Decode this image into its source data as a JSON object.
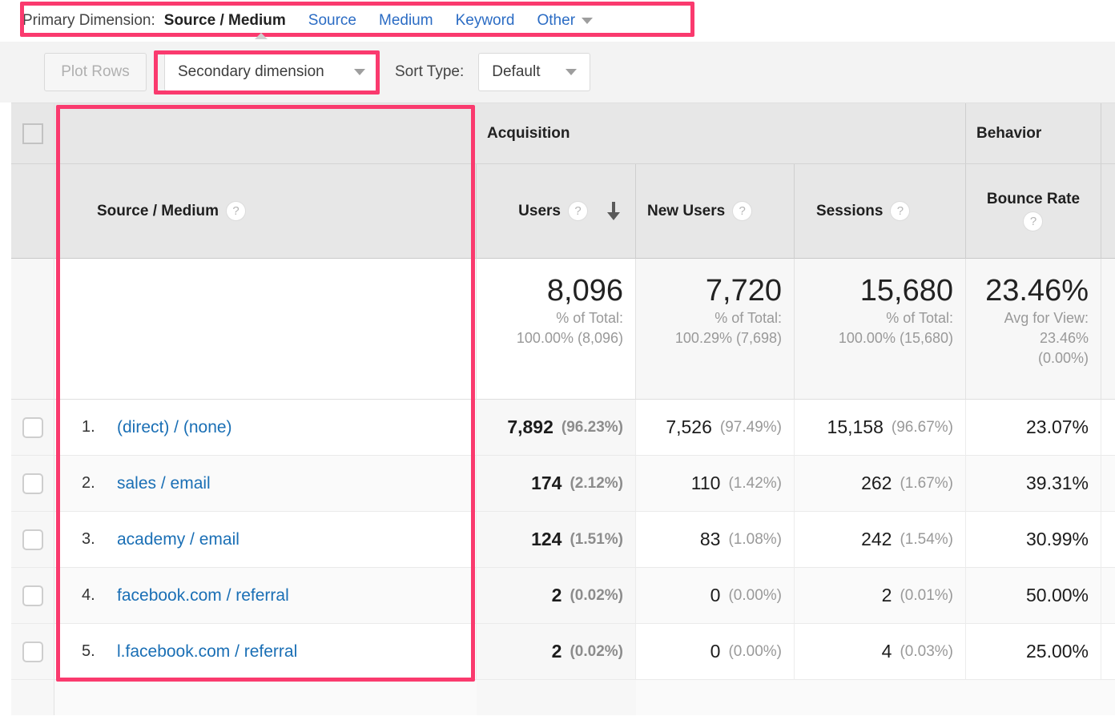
{
  "primary_dimension": {
    "label": "Primary Dimension:",
    "active": "Source / Medium",
    "links": [
      "Source",
      "Medium",
      "Keyword"
    ],
    "other": "Other",
    "other_caret_icon": "chevron-down-icon"
  },
  "controls": {
    "plot_rows_label": "Plot Rows",
    "secondary_dimension_label": "Secondary dimension",
    "secondary_dimension_caret_icon": "chevron-down-icon",
    "sort_type_label": "Sort Type:",
    "sort_type_value": "Default",
    "sort_type_caret_icon": "chevron-down-icon"
  },
  "highlight_color": "#fa3a6e",
  "link_color": "#1a6fb5",
  "table": {
    "groups": [
      {
        "label": "Acquisition"
      },
      {
        "label": "Behavior"
      }
    ],
    "dimension_header": {
      "label": "Source / Medium",
      "help_icon": "help-circle-icon"
    },
    "metrics": [
      {
        "label": "Users",
        "help_icon": "help-circle-icon",
        "sorted": true,
        "sort_icon": "arrow-down-icon"
      },
      {
        "label": "New Users",
        "help_icon": "help-circle-icon",
        "sorted": false
      },
      {
        "label": "Sessions",
        "help_icon": "help-circle-icon",
        "sorted": false
      },
      {
        "label": "Bounce Rate",
        "help_icon": "help-circle-icon",
        "sorted": false
      }
    ],
    "totals": [
      {
        "value": "8,096",
        "sub_label": "% of Total:",
        "sub_value": "100.00% (8,096)"
      },
      {
        "value": "7,720",
        "sub_label": "% of Total:",
        "sub_value": "100.29% (7,698)"
      },
      {
        "value": "15,680",
        "sub_label": "% of Total:",
        "sub_value": "100.00% (15,680)"
      },
      {
        "value": "23.46%",
        "sub_label": "Avg for View:",
        "sub_value": "23.46%",
        "sub_value2": "(0.00%)"
      }
    ],
    "rows": [
      {
        "index": "1.",
        "dimension": "(direct) / (none)",
        "users": "7,892",
        "users_pct": "(96.23%)",
        "new_users": "7,526",
        "new_users_pct": "(97.49%)",
        "sessions": "15,158",
        "sessions_pct": "(96.67%)",
        "bounce_rate": "23.07%"
      },
      {
        "index": "2.",
        "dimension": "sales / email",
        "users": "174",
        "users_pct": "(2.12%)",
        "new_users": "110",
        "new_users_pct": "(1.42%)",
        "sessions": "262",
        "sessions_pct": "(1.67%)",
        "bounce_rate": "39.31%"
      },
      {
        "index": "3.",
        "dimension": "academy / email",
        "users": "124",
        "users_pct": "(1.51%)",
        "new_users": "83",
        "new_users_pct": "(1.08%)",
        "sessions": "242",
        "sessions_pct": "(1.54%)",
        "bounce_rate": "30.99%"
      },
      {
        "index": "4.",
        "dimension": "facebook.com / referral",
        "users": "2",
        "users_pct": "(0.02%)",
        "new_users": "0",
        "new_users_pct": "(0.00%)",
        "sessions": "2",
        "sessions_pct": "(0.01%)",
        "bounce_rate": "50.00%"
      },
      {
        "index": "5.",
        "dimension": "l.facebook.com / referral",
        "users": "2",
        "users_pct": "(0.02%)",
        "new_users": "0",
        "new_users_pct": "(0.00%)",
        "sessions": "4",
        "sessions_pct": "(0.03%)",
        "bounce_rate": "25.00%"
      }
    ]
  }
}
